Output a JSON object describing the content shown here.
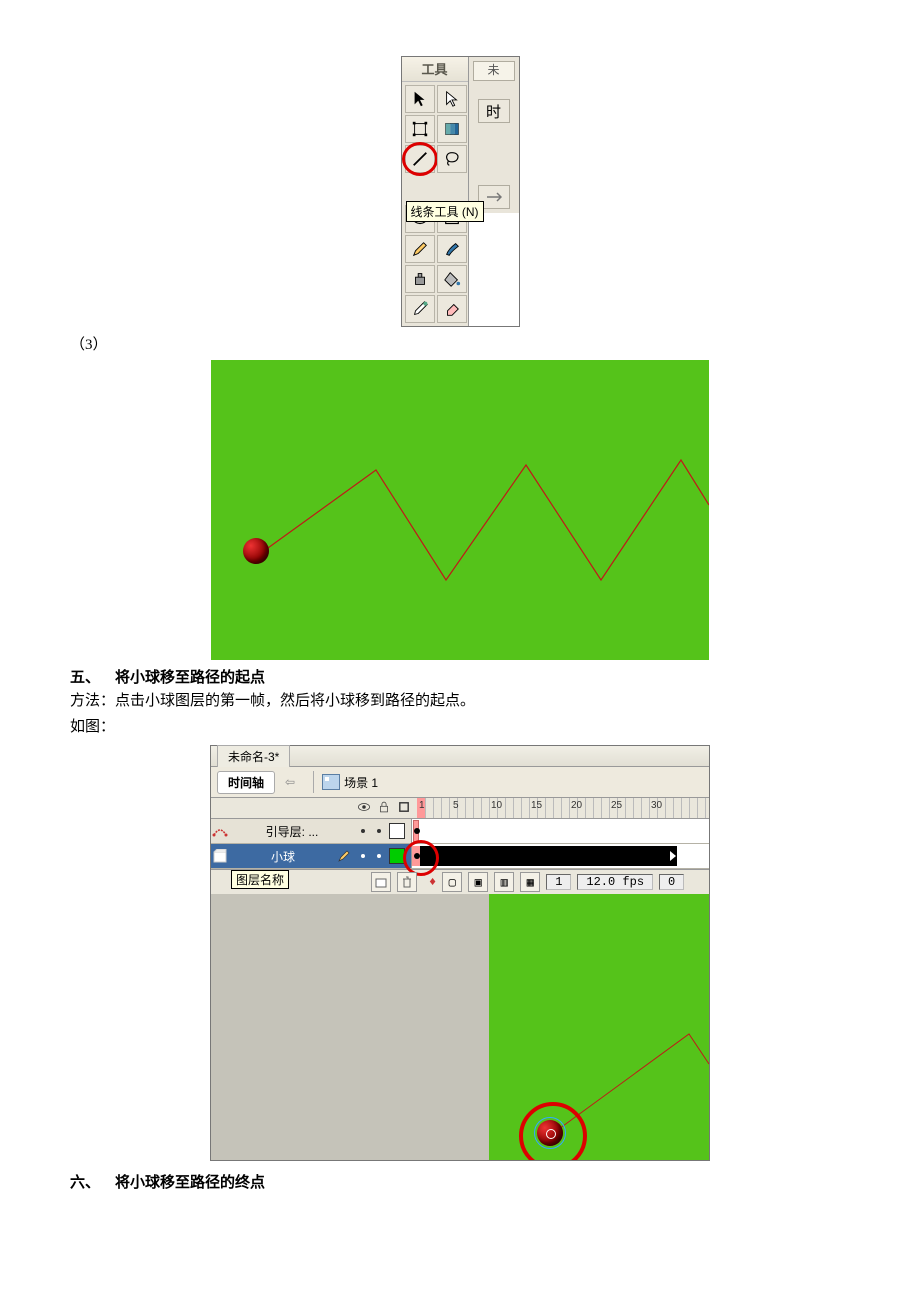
{
  "tools": {
    "title": "工具",
    "tooltip": "线条工具 (N)",
    "adj_tab": "未"
  },
  "step3_label": "（3）",
  "section5": {
    "heading_num": "五、",
    "heading_text": "将小球移至路径的起点",
    "method": "方法：点击小球图层的第一帧，然后将小球移到路径的起点。",
    "fig_label": "如图："
  },
  "timeline": {
    "doc_tab": "未命名-3*",
    "timeline_tab": "时间轴",
    "scene": "场景 1",
    "ruler": {
      "m1": "1",
      "m5": "5",
      "m10": "10",
      "m15": "15",
      "m20": "20",
      "m25": "25",
      "m30": "30"
    },
    "guide_layer": "引导层: ...",
    "ball_layer": "小球",
    "layer_name_tip": "图层名称",
    "frame_num": "1",
    "fps": "12.0 fps",
    "elapsed": "0"
  },
  "section6": {
    "heading_num": "六、",
    "heading_text": "将小球移至路径的终点"
  }
}
